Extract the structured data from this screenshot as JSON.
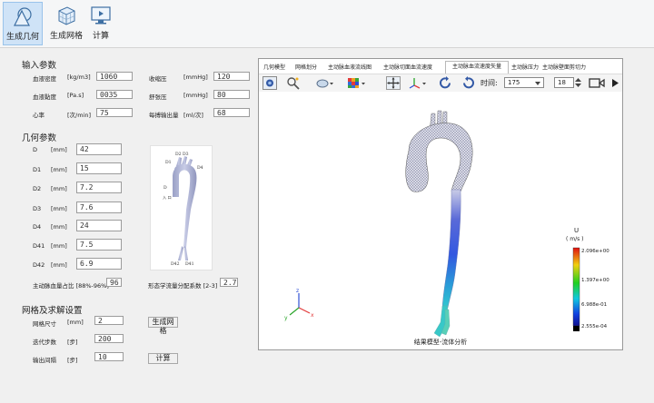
{
  "ribbon": {
    "buttons": [
      {
        "label": "生成几何",
        "icon": "geometry-icon"
      },
      {
        "label": "生成网格",
        "icon": "mesh-cube-icon"
      },
      {
        "label": "计算",
        "icon": "compute-monitor-icon"
      }
    ]
  },
  "input_params": {
    "title": "输入参数",
    "rows": [
      {
        "label": "血液密度",
        "unit": "[kg/m3]",
        "value": "1060"
      },
      {
        "label": "收缩压",
        "unit": "[mmHg]",
        "value": "120"
      },
      {
        "label": "血液黏度",
        "unit": "[Pa.s]",
        "value": "0035"
      },
      {
        "label": "舒张压",
        "unit": "[mmHg]",
        "value": "80"
      },
      {
        "label": "心率",
        "unit": "[次/min]",
        "value": "75"
      },
      {
        "label": "每搏输出量",
        "unit": "[ml/次]",
        "value": "68"
      }
    ]
  },
  "geometry_params": {
    "title": "几何参数",
    "rows": [
      {
        "label": "D",
        "unit": "[mm]",
        "value": "42"
      },
      {
        "label": "D1",
        "unit": "[mm]",
        "value": "15"
      },
      {
        "label": "D2",
        "unit": "[mm]",
        "value": "7.2"
      },
      {
        "label": "D3",
        "unit": "[mm]",
        "value": "7.6"
      },
      {
        "label": "D4",
        "unit": "[mm]",
        "value": "24"
      },
      {
        "label": "D41",
        "unit": "[mm]",
        "value": "7.5"
      },
      {
        "label": "D42",
        "unit": "[mm]",
        "value": "6.9"
      }
    ],
    "ratio_label": "主动脉血量占比 [88%-96%]",
    "ratio_value": "96",
    "shape_label": "形态学流量分配系数 [2-3]",
    "shape_value": "2.7",
    "diagram_labels": [
      "D2",
      "D3",
      "D1",
      "D4",
      "D",
      "入 口",
      "D42",
      "D41"
    ]
  },
  "mesh_params": {
    "title": "网格及求解设置",
    "rows": [
      {
        "label": "网格尺寸",
        "unit": "[mm]",
        "value": "2"
      },
      {
        "label": "迭代步数",
        "unit": "[步]",
        "value": "200"
      },
      {
        "label": "输出间隔",
        "unit": "[步]",
        "value": "10"
      }
    ],
    "gen_mesh_btn": "生成网格",
    "compute_btn": "计算"
  },
  "viewer": {
    "tabs": [
      "几何模型",
      "网格划分",
      "主动脉血液流线图",
      "主动脉切面血流速度",
      "主动脉血流速度矢量",
      "主动脉压力",
      "主动脉壁面剪切力"
    ],
    "time_label": "时间:",
    "time_value": "175",
    "step_value": "18",
    "caption": "结果模型-流体分析",
    "axis": {
      "x": "x",
      "y": "y",
      "z": "z"
    },
    "colors": {
      "axis_x": "#e23a3a",
      "axis_y": "#2aa52a",
      "axis_z": "#2f4fd6"
    }
  },
  "colorbar": {
    "title": "U",
    "unit": "( m/s )",
    "ticks": [
      "2.096e+00",
      "1.397e+00",
      "6.988e-01",
      "2.555e-04"
    ]
  }
}
